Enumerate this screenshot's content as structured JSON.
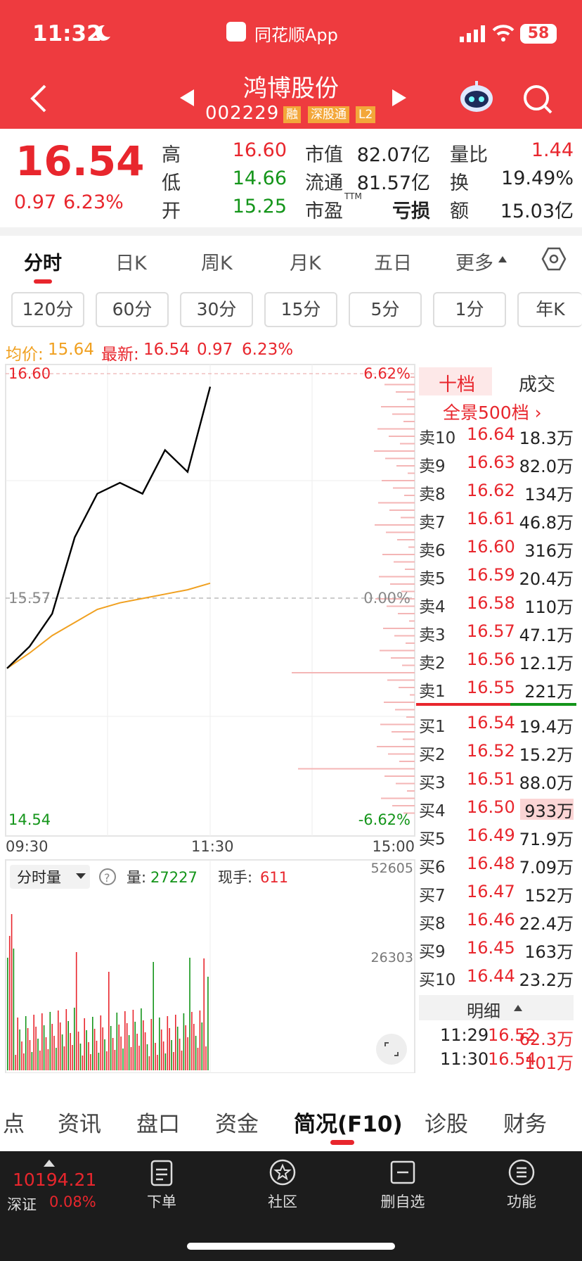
{
  "status_bar": {
    "time": "11:32",
    "app_name": "同花顺App",
    "battery": "58"
  },
  "header": {
    "stock_name": "鸿博股份",
    "stock_code": "002229",
    "tags": [
      "融",
      "深股通",
      "L2"
    ]
  },
  "quote": {
    "price": "16.54",
    "change": "0.97",
    "change_pct": "6.23%",
    "high_label": "高",
    "high": "16.60",
    "low_label": "低",
    "low": "14.66",
    "open_label": "开",
    "open": "15.25",
    "mktcap_label": "市值",
    "mktcap": "82.07亿",
    "float_label": "流通",
    "float": "81.57亿",
    "pe_label": "市盈",
    "pe_sup": "TTM",
    "pe": "亏损",
    "volratio_label": "量比",
    "volratio": "1.44",
    "turnover_label": "换",
    "turnover": "19.49%",
    "amount_label": "额",
    "amount": "15.03亿"
  },
  "tabs": [
    "分时",
    "日K",
    "周K",
    "月K",
    "五日",
    "更多"
  ],
  "periods": [
    "120分",
    "60分",
    "30分",
    "15分",
    "5分",
    "1分",
    "年K"
  ],
  "info_line": {
    "avg_label": "均价:",
    "avg": "15.64",
    "latest_label": "最新:",
    "latest": "16.54",
    "chg": "0.97",
    "pct": "6.23%"
  },
  "chart": {
    "y_high": "16.60",
    "y_mid": "15.57",
    "y_low": "14.54",
    "pct_high": "6.62%",
    "pct_mid": "0.00%",
    "pct_low": "-6.62%",
    "x_labels": [
      "09:30",
      "11:30",
      "15:00"
    ],
    "vol_selector": "分时量",
    "vol_label": "量:",
    "vol_value": "27227",
    "hand_label": "现手:",
    "hand_value": "611",
    "vol_max": "52605",
    "vol_mid": "26303"
  },
  "chart_data": {
    "type": "line",
    "title": "",
    "x": [
      "09:30",
      "09:45",
      "10:00",
      "10:15",
      "10:30",
      "10:45",
      "11:00",
      "11:15",
      "11:25",
      "11:30"
    ],
    "series": [
      {
        "name": "最新",
        "values": [
          15.25,
          15.35,
          15.5,
          15.85,
          16.05,
          16.1,
          16.05,
          16.25,
          16.15,
          16.54
        ]
      },
      {
        "name": "均价",
        "values": [
          15.25,
          15.32,
          15.4,
          15.46,
          15.52,
          15.55,
          15.57,
          15.59,
          15.61,
          15.64
        ]
      }
    ],
    "ylim": [
      14.54,
      16.6
    ],
    "ref_price": 15.57
  },
  "orderbook": {
    "tab_active": "十档",
    "tab_other": "成交",
    "full_depth": "全景500档 ›",
    "asks": [
      {
        "label": "卖10",
        "price": "16.64",
        "vol": "18.3万"
      },
      {
        "label": "卖9",
        "price": "16.63",
        "vol": "82.0万"
      },
      {
        "label": "卖8",
        "price": "16.62",
        "vol": "134万"
      },
      {
        "label": "卖7",
        "price": "16.61",
        "vol": "46.8万"
      },
      {
        "label": "卖6",
        "price": "16.60",
        "vol": "316万"
      },
      {
        "label": "卖5",
        "price": "16.59",
        "vol": "20.4万"
      },
      {
        "label": "卖4",
        "price": "16.58",
        "vol": "110万"
      },
      {
        "label": "卖3",
        "price": "16.57",
        "vol": "47.1万"
      },
      {
        "label": "卖2",
        "price": "16.56",
        "vol": "12.1万"
      },
      {
        "label": "卖1",
        "price": "16.55",
        "vol": "221万"
      }
    ],
    "bids": [
      {
        "label": "买1",
        "price": "16.54",
        "vol": "19.4万"
      },
      {
        "label": "买2",
        "price": "16.52",
        "vol": "15.2万"
      },
      {
        "label": "买3",
        "price": "16.51",
        "vol": "88.0万"
      },
      {
        "label": "买4",
        "price": "16.50",
        "vol": "933万"
      },
      {
        "label": "买5",
        "price": "16.49",
        "vol": "71.9万"
      },
      {
        "label": "买6",
        "price": "16.48",
        "vol": "7.09万"
      },
      {
        "label": "买7",
        "price": "16.47",
        "vol": "152万"
      },
      {
        "label": "买8",
        "price": "16.46",
        "vol": "22.4万"
      },
      {
        "label": "买9",
        "price": "16.45",
        "vol": "163万"
      },
      {
        "label": "买10",
        "price": "16.44",
        "vol": "23.2万"
      }
    ],
    "detail_label": "明细",
    "trades": [
      {
        "time": "11:29",
        "price": "16.52",
        "vol": "62.3万"
      },
      {
        "time": "11:30",
        "price": "16.54",
        "vol": "101万"
      }
    ]
  },
  "sub_tabs": [
    "点",
    "资讯",
    "盘口",
    "资金",
    "简况(F10)",
    "诊股",
    "财务"
  ],
  "bottom_bar": {
    "index_value": "10194.21",
    "index_name": "深证",
    "index_pct": "0.08%",
    "items": [
      "下单",
      "社区",
      "删自选",
      "功能"
    ]
  },
  "colors": {
    "brand_red": "#ee3b3f",
    "up": "#e8262d",
    "down": "#14951a"
  }
}
